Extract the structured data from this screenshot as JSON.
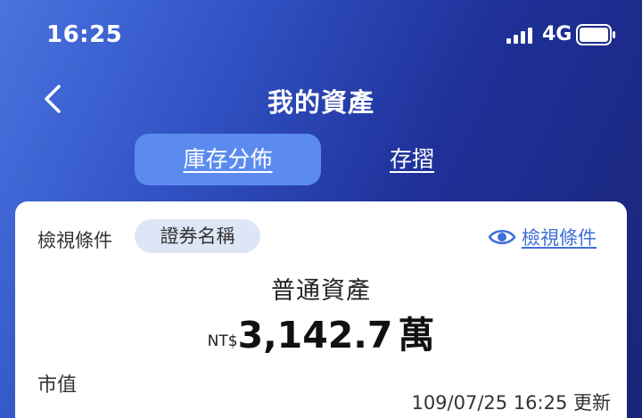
{
  "status_bar": {
    "time": "16:25",
    "network": "4G"
  },
  "nav": {
    "title": "我的資產"
  },
  "tabs": [
    {
      "label": "庫存分佈",
      "active": true
    },
    {
      "label": "存摺",
      "active": false
    }
  ],
  "card": {
    "filter_label": "檢視條件",
    "filter_chip": "證券名稱",
    "view_conditions_link": "檢視條件",
    "asset_title": "普通資產",
    "currency": "NT$",
    "amount": "3,142.7",
    "unit": "萬",
    "market_value_label": "市值",
    "update_time": "109/07/25 16:25 更新"
  },
  "colors": {
    "accent": "#3e6fd6",
    "tab_active_bg": "#5c8bf0",
    "chip_bg": "#dde6f6"
  }
}
